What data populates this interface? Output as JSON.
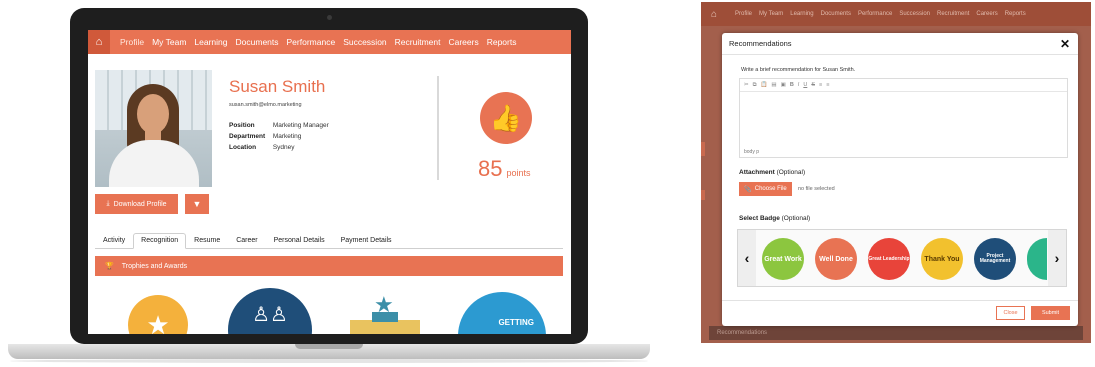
{
  "colors": {
    "accent": "#e87353",
    "dark_frame": "#1e1e1e",
    "overlay": "#a35f4c"
  },
  "nav": {
    "items": [
      "Profile",
      "My Team",
      "Learning",
      "Documents",
      "Performance",
      "Succession",
      "Recruitment",
      "Careers",
      "Reports"
    ]
  },
  "profile": {
    "name": "Susan Smith",
    "email": "susan.smith@elmo.marketing",
    "fields": [
      {
        "label": "Position",
        "value": "Marketing Manager"
      },
      {
        "label": "Department",
        "value": "Marketing"
      },
      {
        "label": "Location",
        "value": "Sydney"
      }
    ],
    "points_value": "85",
    "points_label": "points",
    "download_label": "Download Profile"
  },
  "tabs": [
    "Activity",
    "Recognition",
    "Resume",
    "Career",
    "Personal Details",
    "Payment Details"
  ],
  "active_tab": "Recognition",
  "trophies_label": "Trophies and Awards",
  "award_getting_text": "GETTING",
  "modal": {
    "title": "Recommendations",
    "instruction": "Write a brief recommendation for Susan Smith.",
    "editor_footer": "body  p",
    "attachment_label": "Attachment",
    "attachment_optional": "(Optional)",
    "choose_file_label": "Choose File",
    "no_file_text": "no file selected",
    "badge_label": "Select Badge",
    "badge_optional": "(Optional)",
    "badges": [
      {
        "text": "Great Work",
        "color": "#8cc63f"
      },
      {
        "text": "Well Done",
        "color": "#e87353"
      },
      {
        "text": "Great Leadership",
        "color": "#e8443a"
      },
      {
        "text": "Thank You",
        "color": "#f2c12e"
      },
      {
        "text": "Project Management",
        "color": "#1f4e79"
      },
      {
        "text": "",
        "color": "#2bb58a"
      }
    ],
    "close_label": "Close",
    "submit_label": "Submit"
  },
  "bg_nav": [
    "Profile",
    "My Team",
    "Learning",
    "Documents",
    "Performance",
    "Succession",
    "Recruitment",
    "Careers",
    "Reports"
  ],
  "bg_bottom_label": "Recommendations"
}
